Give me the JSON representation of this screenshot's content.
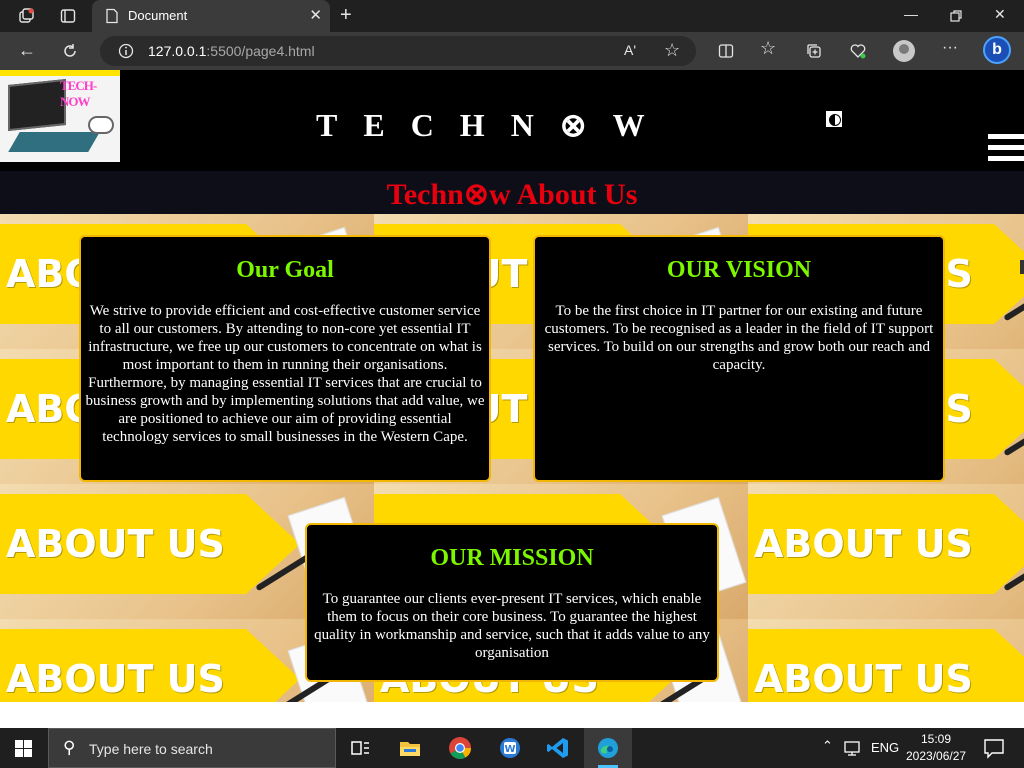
{
  "browser": {
    "tab_title": "Document",
    "tab_close": "✕",
    "new_tab": "+",
    "url_host": "127.0.0.1",
    "url_rest": ":5500/page4.html",
    "read_aloud": "Aʹ",
    "more": "···"
  },
  "site": {
    "logo_text": "TECH-NOW",
    "title": "TECHN⊗W",
    "banner": "Techn⊗w About Us",
    "background_label": "ABOUT US"
  },
  "cards": {
    "goal": {
      "heading": "Our Goal",
      "body": "We strive to provide efficient and cost-effective customer service to all our customers. By attending to non-core yet essential IT infrastructure, we free up our customers to concentrate on what is most important to them in running their organisations. Furthermore, by managing essential IT services that are crucial to business growth and by implementing solutions that add value, we are positioned to achieve our aim of providing essential technology services to small businesses in the Western Cape."
    },
    "vision": {
      "heading": "OUR VISION",
      "body": "To be the first choice in IT partner for our existing and future customers. To be recognised as a leader in the field of IT support services. To build on our strengths and grow both our reach and capacity."
    },
    "mission": {
      "heading": "OUR MISSION",
      "body": "To guarantee our clients ever-present IT services, which enable them to focus on their core business. To guarantee the highest quality in workmanship and service, such that it adds value to any organisation"
    }
  },
  "taskbar": {
    "search_placeholder": "Type here to search",
    "language": "ENG",
    "time": "15:09",
    "date": "2023/06/27"
  },
  "colors": {
    "card_heading": "#7cf700",
    "card_border": "#f2b705",
    "banner_text": "#e8000f",
    "bg_arrow": "#ffd800"
  }
}
